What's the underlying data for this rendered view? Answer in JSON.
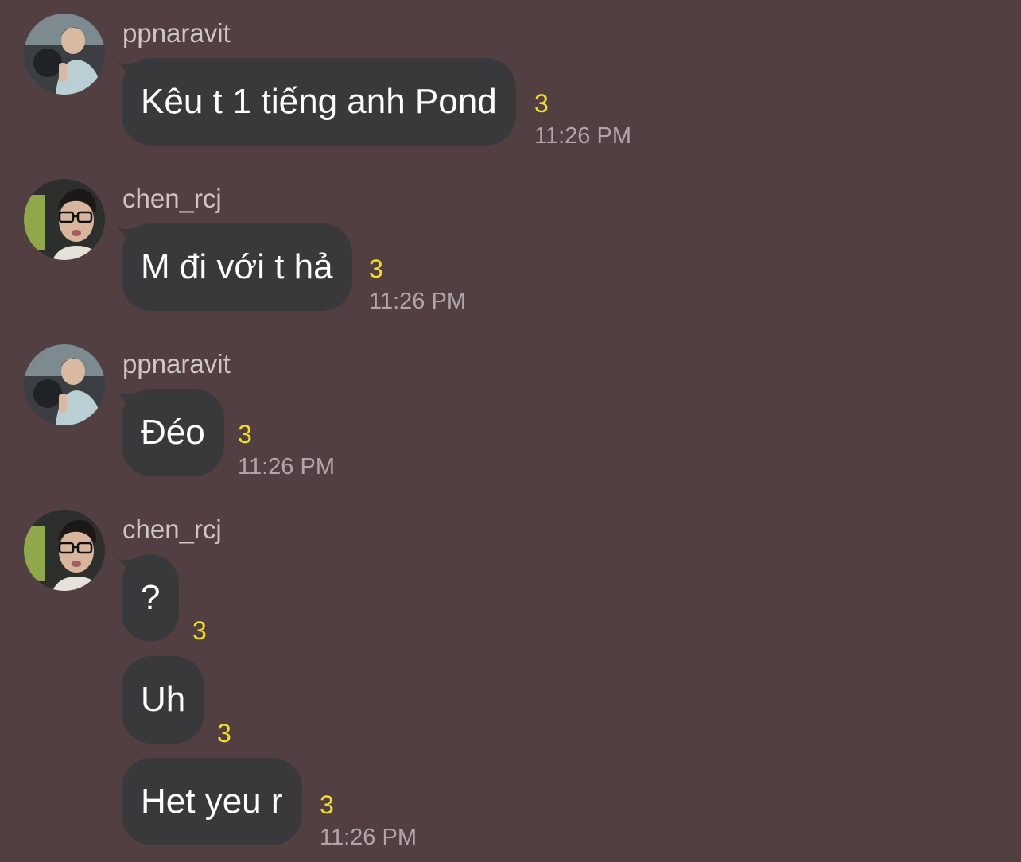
{
  "messages": [
    {
      "user": "ppnaravit",
      "avatar_icon": "user-avatar-ppnaravit",
      "text": "Kêu t 1 tiếng anh Pond",
      "count": "3",
      "time": "11:26 PM"
    },
    {
      "user": "chen_rcj",
      "avatar_icon": "user-avatar-chen_rcj",
      "text": "M đi với t hả",
      "count": "3",
      "time": "11:26 PM"
    },
    {
      "user": "ppnaravit",
      "avatar_icon": "user-avatar-ppnaravit",
      "text": "Đéo",
      "count": "3",
      "time": "11:26 PM"
    },
    {
      "user": "chen_rcj",
      "avatar_icon": "user-avatar-chen_rcj",
      "bubbles": [
        {
          "text": "?",
          "count": "3"
        },
        {
          "text": "Uh",
          "count": "3"
        },
        {
          "text": "Het yeu r",
          "count": "3",
          "time": "11:26 PM"
        }
      ]
    }
  ],
  "colors": {
    "background": "#523f41",
    "bubble": "#39393b",
    "bubble_text": "#ffffff",
    "username": "#cfc6c6",
    "count": "#f5e11a",
    "timestamp": "#b0a6a7"
  }
}
